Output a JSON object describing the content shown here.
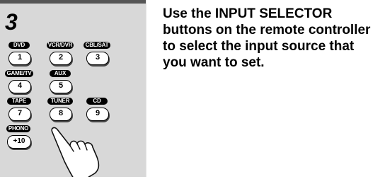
{
  "step": {
    "number": "3"
  },
  "remote": {
    "buttons": [
      {
        "label": "DVD",
        "key": "1"
      },
      {
        "label": "VCR/DVR",
        "key": "2"
      },
      {
        "label": "CBL/SAT",
        "key": "3"
      },
      {
        "label": "GAME/TV",
        "key": "4"
      },
      {
        "label": "AUX",
        "key": "5"
      },
      {
        "label": "TAPE",
        "key": "7"
      },
      {
        "label": "TUNER",
        "key": "8"
      },
      {
        "label": "CD",
        "key": "9"
      },
      {
        "label": "PHONO",
        "key": "+10"
      }
    ]
  },
  "instruction": {
    "text": "Use the INPUT SELECTOR buttons on the remote controller to select the input source that you want to set."
  }
}
